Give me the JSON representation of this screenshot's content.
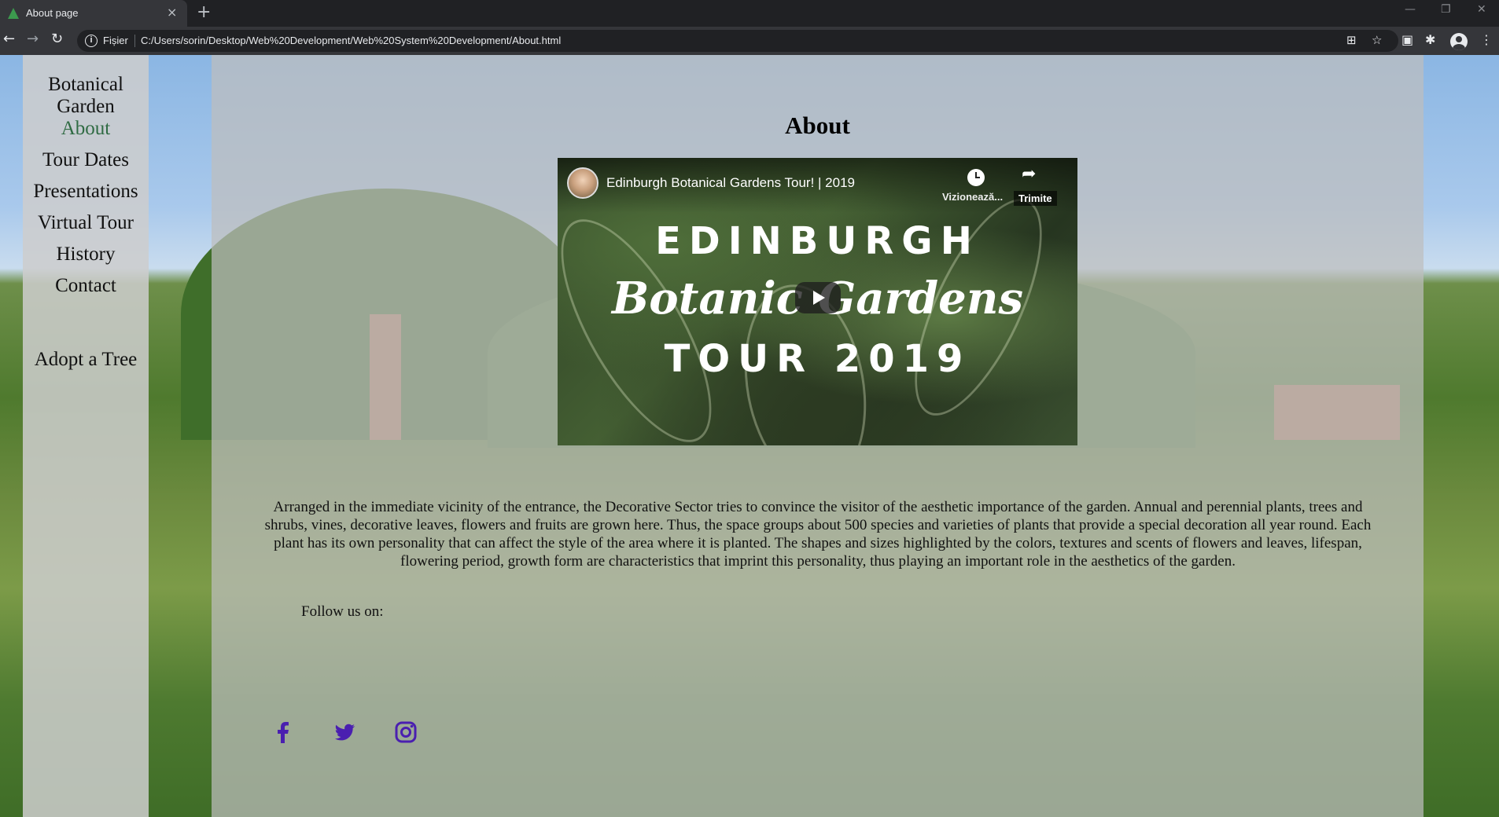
{
  "browser": {
    "tab_title": "About page",
    "tab_close": "×",
    "new_tab": "+",
    "scheme_label": "Fișier",
    "url": "C:/Users/sorin/Desktop/Web%20Development/Web%20System%20Development/About.html",
    "window_controls": [
      "—",
      "❐",
      "✕"
    ]
  },
  "sidebar": {
    "site_title_line1": "Botanical",
    "site_title_line2": "Garden",
    "items": [
      {
        "label": "About",
        "active": true
      },
      {
        "label": "Tour Dates"
      },
      {
        "label": "Presentations"
      },
      {
        "label": "Virtual Tour"
      },
      {
        "label": "History"
      },
      {
        "label": "Contact"
      }
    ],
    "adopt_label": "Adopt a Tree"
  },
  "main": {
    "heading": "About",
    "video": {
      "title": "Edinburgh Botanical Gardens Tour! | 2019",
      "watch_later_label": "Vizionează...",
      "share_label": "Trimite",
      "overlay_line1": "EDINBURGH",
      "overlay_line2": "Botanic Gardens",
      "overlay_line3": "TOUR 2019"
    },
    "description": "Arranged in the immediate vicinity of the entrance, the Decorative Sector tries to convince the visitor of the aesthetic importance of the garden. Annual and perennial plants, trees and shrubs, vines, decorative leaves, flowers and fruits are grown here. Thus, the space groups about 500 species and varieties of plants that provide a special decoration all year round. Each plant has its own personality that can affect the style of the area where it is planted. The shapes and sizes highlighted by the colors, textures and scents of flowers and leaves, lifespan, flowering period, growth form are characteristics that imprint this personality, thus playing an important role in the aesthetics of the garden.",
    "follow_label": "Follow us on:",
    "social_icons": [
      "facebook-icon",
      "twitter-icon",
      "instagram-icon"
    ]
  },
  "colors": {
    "active_nav": "#2f6b43",
    "social_icon": "#4a1fb0",
    "chrome_dark": "#202124",
    "chrome": "#35363a"
  }
}
